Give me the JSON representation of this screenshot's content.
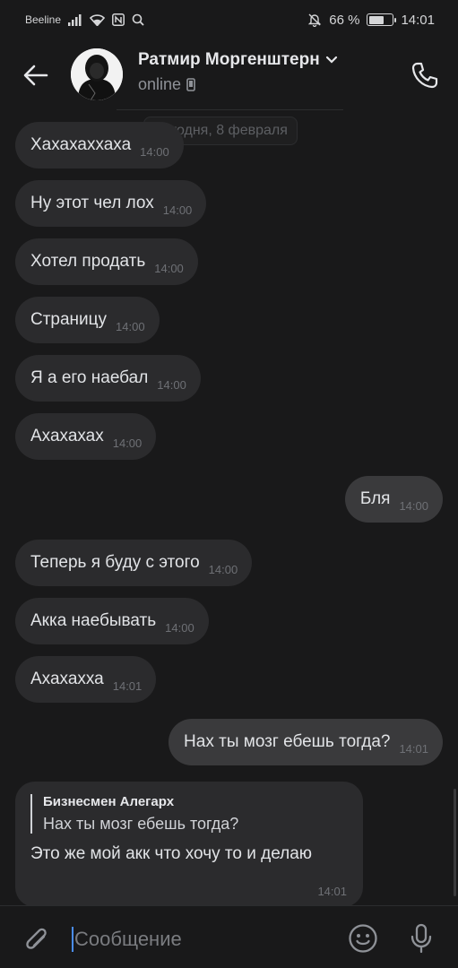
{
  "status_bar": {
    "carrier": "Beeline",
    "battery": "66 %",
    "battery_level": 0.66,
    "time": "14:01"
  },
  "header": {
    "name": "Ратмир Моргенштерн",
    "status": "online"
  },
  "date_separator": "Сегодня, 8 февраля",
  "messages": [
    {
      "text": "Хахахаххаха",
      "time": "14:00",
      "dir": "in"
    },
    {
      "text": "Ну этот чел лох",
      "time": "14:00",
      "dir": "in"
    },
    {
      "text": "Хотел продать",
      "time": "14:00",
      "dir": "in"
    },
    {
      "text": "Страницу",
      "time": "14:00",
      "dir": "in"
    },
    {
      "text": "Я а его наебал",
      "time": "14:00",
      "dir": "in"
    },
    {
      "text": "Ахахахах",
      "time": "14:00",
      "dir": "in"
    },
    {
      "text": "Бля",
      "time": "14:00",
      "dir": "out"
    },
    {
      "text": "Теперь я буду с этого",
      "time": "14:00",
      "dir": "in"
    },
    {
      "text": "Акка наебывать",
      "time": "14:00",
      "dir": "in"
    },
    {
      "text": "Ахахахха",
      "time": "14:01",
      "dir": "in"
    },
    {
      "text": "Нах ты мозг ебешь тогда?",
      "time": "14:01",
      "dir": "out"
    }
  ],
  "reply_message": {
    "quote_author": "Бизнесмен Алегарх",
    "quote_text": "Нах ты мозг ебешь тогда?",
    "text": "Это же мой акк что хочу то и делаю",
    "time": "14:01"
  },
  "composer": {
    "placeholder": "Сообщение"
  }
}
